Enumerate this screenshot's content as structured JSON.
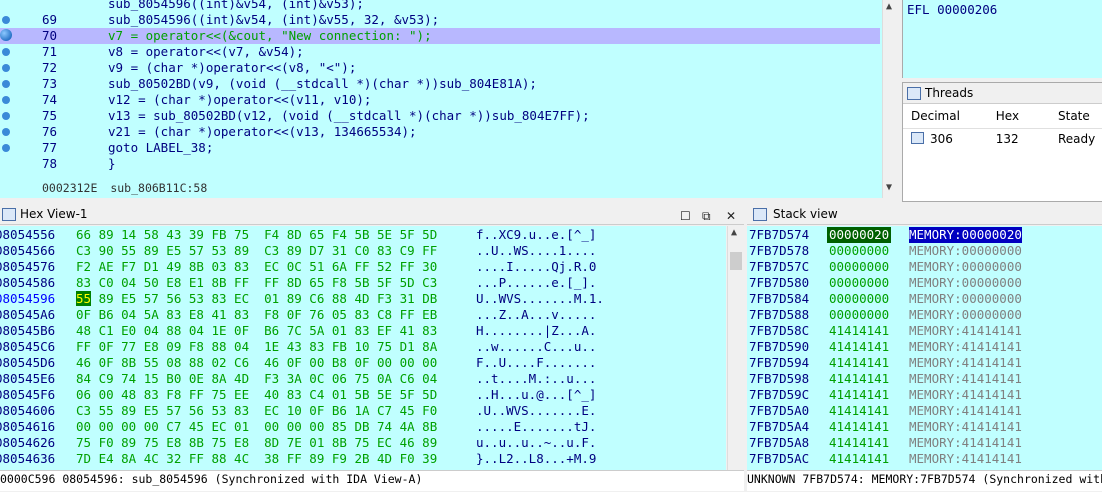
{
  "code": {
    "lines": [
      {
        "num": "",
        "text": "sub_8054596((int)&v54, (int)&v53);",
        "bp": false,
        "cur": false
      },
      {
        "num": "69",
        "text": "sub_8054596((int)&v54, (int)&v55, 32, &v53);",
        "bp": true,
        "cur": false
      },
      {
        "num": "70",
        "text": "v7 = operator<<(&cout, \"New connection: \");",
        "bp": true,
        "cur": true
      },
      {
        "num": "71",
        "text": "v8 = operator<<(v7, &v54);",
        "bp": true,
        "cur": false
      },
      {
        "num": "72",
        "text": "v9 = (char *)operator<<(v8, \"<\");",
        "bp": true,
        "cur": false
      },
      {
        "num": "73",
        "text": "sub_80502BD(v9, (void (__stdcall *)(char *))sub_804E81A);",
        "bp": true,
        "cur": false
      },
      {
        "num": "74",
        "text": "v12 = (char *)operator<<(v11, v10);",
        "bp": true,
        "cur": false
      },
      {
        "num": "75",
        "text": "v13 = sub_80502BD(v12, (void (__stdcall *)(char *))sub_804E7FF);",
        "bp": true,
        "cur": false
      },
      {
        "num": "76",
        "text": "v21 = (char *)operator<<(v13, 134665534);",
        "bp": true,
        "cur": false
      },
      {
        "num": "77",
        "text": "goto LABEL_38;",
        "bp": true,
        "cur": false
      },
      {
        "num": "78",
        "text": "}",
        "bp": false,
        "cur": false
      }
    ],
    "status_addr": "0002312E",
    "status_func": "sub_806B11C:58"
  },
  "registers": {
    "efl_label": "EFL",
    "efl_value": "00000206"
  },
  "threads": {
    "title": "Threads",
    "columns": [
      "Decimal",
      "Hex",
      "State"
    ],
    "rows": [
      {
        "decimal": "306",
        "hex": "132",
        "state": "Ready"
      }
    ]
  },
  "hex_view": {
    "title": "Hex View-1",
    "rows": [
      {
        "addr": "08054556",
        "bytes": "66 89 14 58 43 39 FB 75  F4 8D 65 F4 5B 5E 5F 5D",
        "ascii": "f..XC9.u..e.[^_]"
      },
      {
        "addr": "08054566",
        "bytes": "C3 90 55 89 E5 57 53 89  C3 89 D7 31 C0 83 C9 FF",
        "ascii": "..U..WS....1...."
      },
      {
        "addr": "08054576",
        "bytes": "F2 AE F7 D1 49 8B 03 83  EC 0C 51 6A FF 52 FF 30",
        "ascii": "....I.....Qj.R.0"
      },
      {
        "addr": "08054586",
        "bytes": "83 C0 04 50 E8 E1 8B FF  FF 8D 65 F8 5B 5F 5D C3",
        "ascii": "...P......e.[_]."
      },
      {
        "addr": "08054596",
        "bytes": "55 89 E5 57 56 53 83 EC  01 89 C6 88 4D F3 31 DB",
        "ascii": "U..WVS.......M.1.",
        "cur": true
      },
      {
        "addr": "080545A6",
        "bytes": "0F B6 04 5A 83 E8 41 83  F8 0F 76 05 83 C8 FF EB",
        "ascii": "...Z..A...v....."
      },
      {
        "addr": "080545B6",
        "bytes": "48 C1 E0 04 88 04 1E 0F  B6 7C 5A 01 83 EF 41 83",
        "ascii": "H........|Z...A."
      },
      {
        "addr": "080545C6",
        "bytes": "FF 0F 77 E8 09 F8 88 04  1E 43 83 FB 10 75 D1 8A",
        "ascii": "..w......C...u.."
      },
      {
        "addr": "080545D6",
        "bytes": "46 0F 8B 55 08 88 02 C6  46 0F 00 B8 0F 00 00 00",
        "ascii": "F..U....F......."
      },
      {
        "addr": "080545E6",
        "bytes": "84 C9 74 15 B0 0E 8A 4D  F3 3A 0C 06 75 0A C6 04",
        "ascii": "..t....M.:..u..."
      },
      {
        "addr": "080545F6",
        "bytes": "06 00 48 83 F8 FF 75 EE  40 83 C4 01 5B 5E 5F 5D",
        "ascii": "..H...u.@...[^_]"
      },
      {
        "addr": "08054606",
        "bytes": "C3 55 89 E5 57 56 53 83  EC 10 0F B6 1A C7 45 F0",
        "ascii": ".U..WVS.......E."
      },
      {
        "addr": "08054616",
        "bytes": "00 00 00 00 C7 45 EC 01  00 00 00 85 DB 74 4A 8B",
        "ascii": ".....E.......tJ."
      },
      {
        "addr": "08054626",
        "bytes": "75 F0 89 75 E8 8B 75 E8  8D 7E 01 8B 75 EC 46 89",
        "ascii": "u..u..u..~..u.F."
      },
      {
        "addr": "08054636",
        "bytes": "7D E4 8A 4C 32 FF 88 4C  38 FF 89 F9 2B 4D F0 39",
        "ascii": "}..L2..L8...+M.9"
      }
    ],
    "status_offset": "0000C596",
    "status_addr": "08054596: sub_8054596",
    "status_sync": "(Synchronized with IDA View-A)"
  },
  "stack_view": {
    "title": "Stack view",
    "rows": [
      {
        "addr": "7FB7D574",
        "value": "00000020",
        "comment": "MEMORY:00000020",
        "sel": true
      },
      {
        "addr": "7FB7D578",
        "value": "00000000",
        "comment": "MEMORY:00000000"
      },
      {
        "addr": "7FB7D57C",
        "value": "00000000",
        "comment": "MEMORY:00000000"
      },
      {
        "addr": "7FB7D580",
        "value": "00000000",
        "comment": "MEMORY:00000000"
      },
      {
        "addr": "7FB7D584",
        "value": "00000000",
        "comment": "MEMORY:00000000"
      },
      {
        "addr": "7FB7D588",
        "value": "00000000",
        "comment": "MEMORY:00000000"
      },
      {
        "addr": "7FB7D58C",
        "value": "41414141",
        "comment": "MEMORY:41414141"
      },
      {
        "addr": "7FB7D590",
        "value": "41414141",
        "comment": "MEMORY:41414141"
      },
      {
        "addr": "7FB7D594",
        "value": "41414141",
        "comment": "MEMORY:41414141"
      },
      {
        "addr": "7FB7D598",
        "value": "41414141",
        "comment": "MEMORY:41414141"
      },
      {
        "addr": "7FB7D59C",
        "value": "41414141",
        "comment": "MEMORY:41414141"
      },
      {
        "addr": "7FB7D5A0",
        "value": "41414141",
        "comment": "MEMORY:41414141"
      },
      {
        "addr": "7FB7D5A4",
        "value": "41414141",
        "comment": "MEMORY:41414141"
      },
      {
        "addr": "7FB7D5A8",
        "value": "41414141",
        "comment": "MEMORY:41414141"
      },
      {
        "addr": "7FB7D5AC",
        "value": "41414141",
        "comment": "MEMORY:41414141"
      }
    ],
    "status": "UNKNOWN 7FB7D574: MEMORY:7FB7D574 (Synchronized with"
  }
}
